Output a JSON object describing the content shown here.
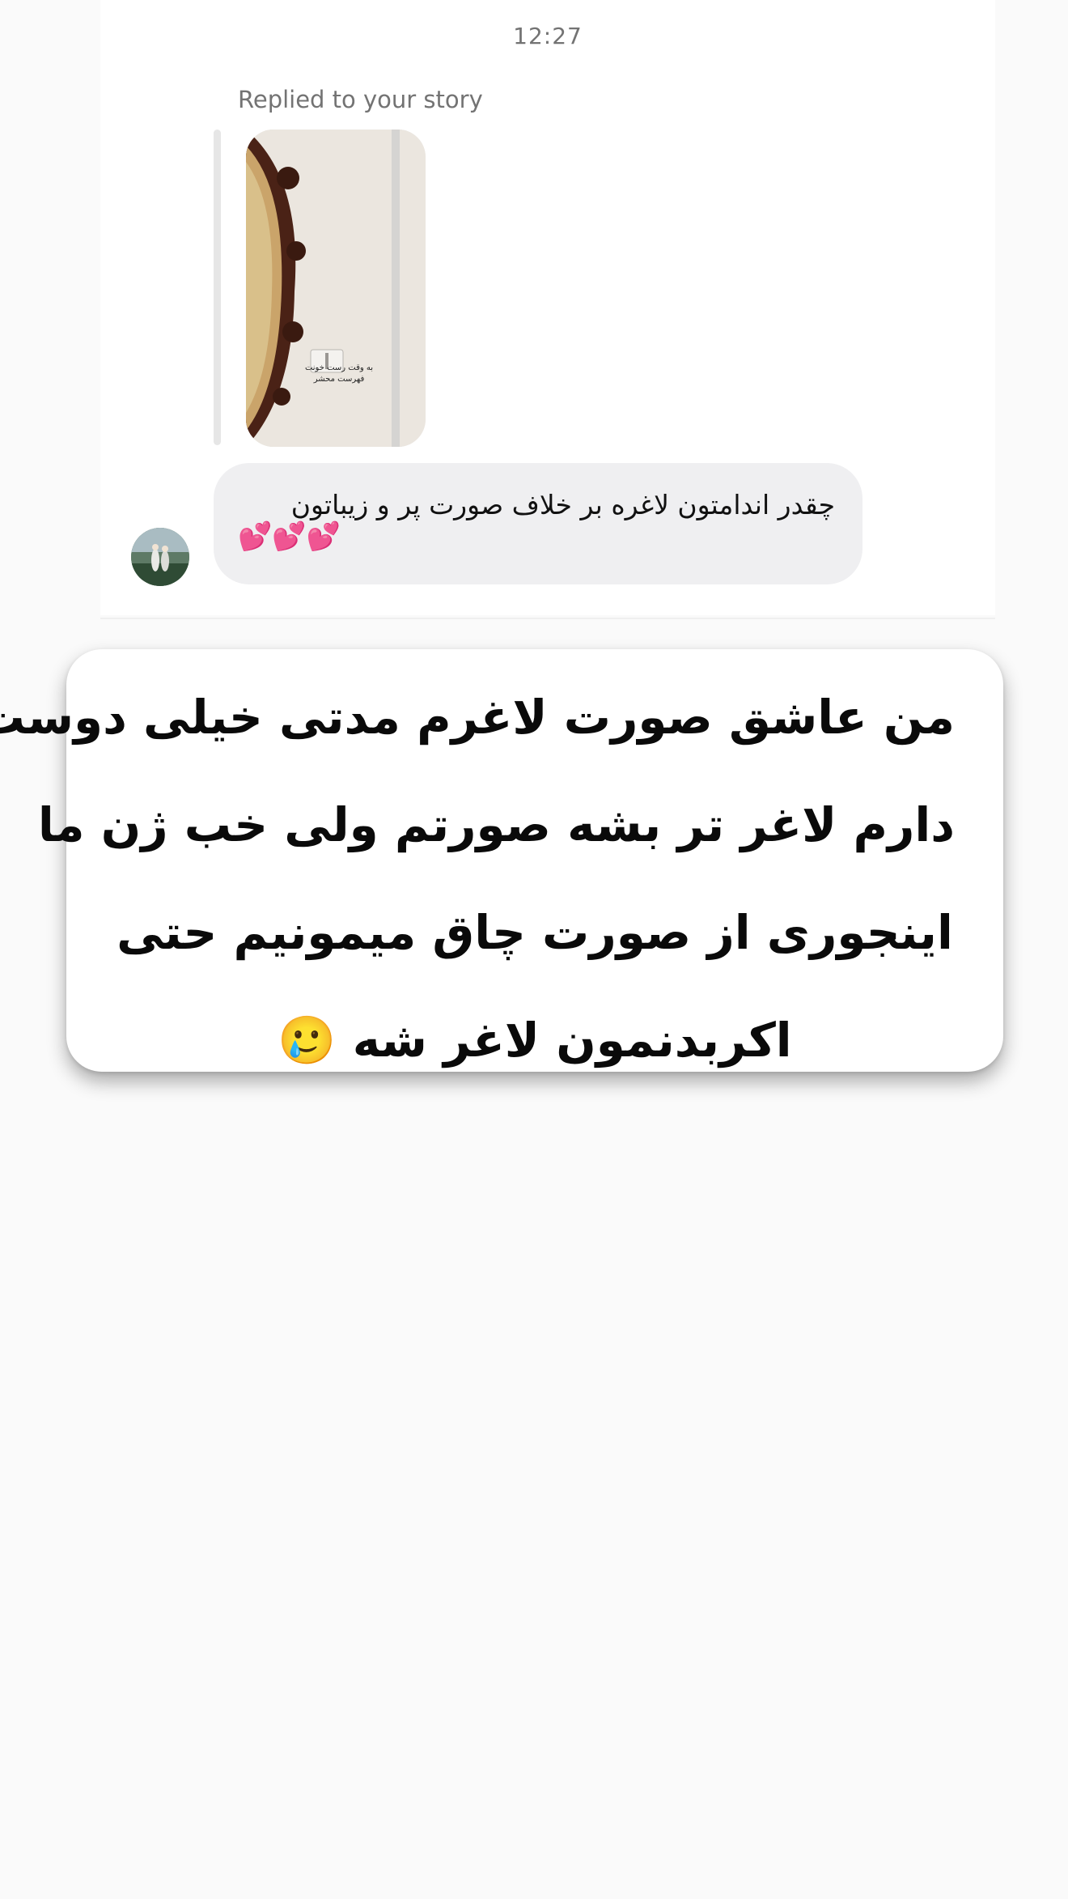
{
  "conversation": {
    "timestamp": "12:27",
    "reply_label": "Replied to your story",
    "story_thumbnail": {
      "description_icon": "story-image",
      "overlay_text": "به وقت رست خونت فهرست محشر"
    },
    "message": {
      "text": "چقدر اندامتون لاغره بر خلاف صورت پر و زیباتون",
      "emojis": "💕💕💕"
    }
  },
  "caption": {
    "lines": [
      "من عاشق صورت لاغرم مدتی خیلی دوست",
      "دارم لاغر تر بشه صورتم ولی خب ژن ما",
      "اینجوری از صورت چاق میمونیم حتی",
      "اکربدنمون لاغر شه 🥲"
    ]
  },
  "colors": {
    "bubble": "#efeff1",
    "muted_text": "#737373",
    "hearts": "#e8439c"
  }
}
